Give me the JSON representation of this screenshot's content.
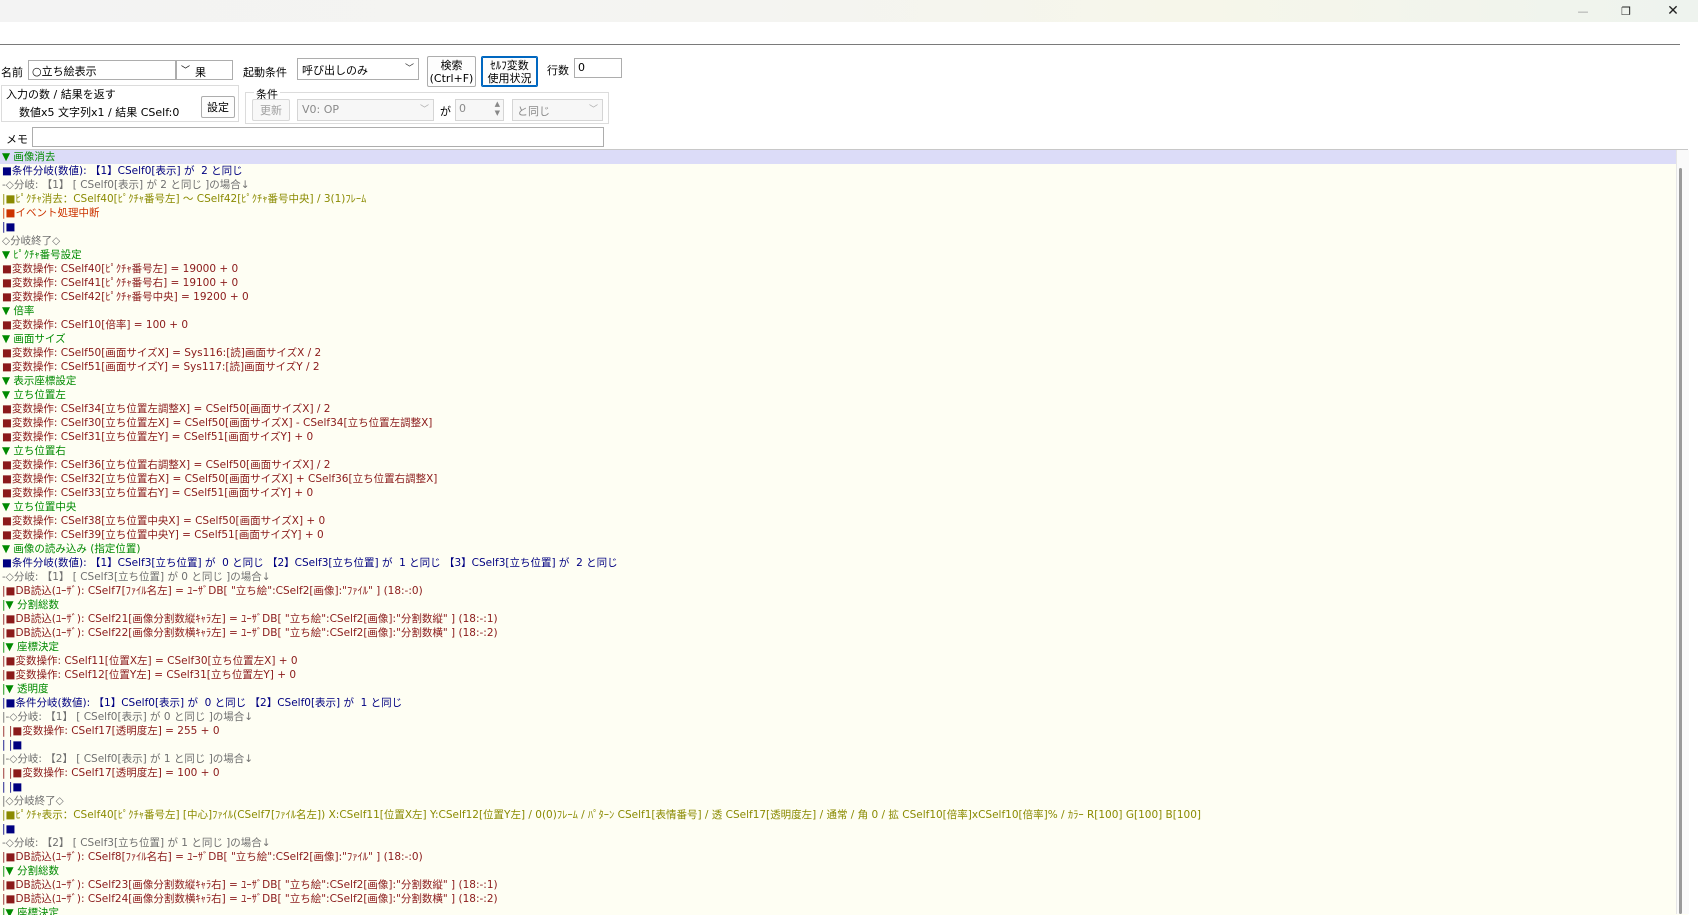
{
  "window": {
    "minimize_glyph": "—",
    "maximize_glyph": "❐",
    "close_glyph": "✕"
  },
  "toolbar": {
    "name_label": "名前",
    "name_value": "○立ち絵表示",
    "view_value": "果",
    "trigger_label": "起動条件",
    "trigger_value": "呼び出しのみ",
    "search_button": [
      "検索",
      "(Ctrl+F)"
    ],
    "self_var_button": [
      "ｾﾙﾌ変数",
      "使用状況"
    ],
    "row_count_label": "行数",
    "row_count_value": "0",
    "io_label": "入力の数 / 結果を返す",
    "io_value": "数値x5 文字列x1 / 結果 CSelf:0",
    "settings_button": "設定",
    "condition_label": "条件",
    "update_button": "更新",
    "cond_var_value": "V0: OP",
    "ga_label": "が",
    "cond_num_value": "0",
    "cond_op_value": "と同じ",
    "memo_label": "メモ",
    "memo_value": ""
  },
  "colors": {
    "comment": "#008a00",
    "command": "#8b1a1a",
    "branch": "#000080",
    "grey": "#707070",
    "picture": "#8a8a00",
    "event": "#cc3300"
  },
  "editor_lines": [
    {
      "t": "▼ 画像消去",
      "c": "comment"
    },
    {
      "t": "■条件分岐(数値): 【1】CSelf0[表示] が  2 と同じ",
      "c": "branch"
    },
    {
      "t": "-◇分岐: 【1】 [ CSelf0[表示] が 2 と同じ ]の場合↓",
      "c": "grey"
    },
    {
      "t": "|■ﾋﾟｸﾁｬ消去：CSelf40[ﾋﾟｸﾁｬ番号左] ～ CSelf42[ﾋﾟｸﾁｬ番号中央] / 3(1)ﾌﾚｰﾑ",
      "c": "picture"
    },
    {
      "t": "|■イベント処理中断",
      "c": "event"
    },
    {
      "t": "|■",
      "c": "branch"
    },
    {
      "t": "◇分岐終了◇",
      "c": "grey"
    },
    {
      "t": "▼ ﾋﾟｸﾁｬ番号設定",
      "c": "comment"
    },
    {
      "t": "■変数操作: CSelf40[ﾋﾟｸﾁｬ番号左] = 19000 + 0",
      "c": "command"
    },
    {
      "t": "■変数操作: CSelf41[ﾋﾟｸﾁｬ番号右] = 19100 + 0",
      "c": "command"
    },
    {
      "t": "■変数操作: CSelf42[ﾋﾟｸﾁｬ番号中央] = 19200 + 0",
      "c": "command"
    },
    {
      "t": "▼ 倍率",
      "c": "comment"
    },
    {
      "t": "■変数操作: CSelf10[倍率] = 100 + 0",
      "c": "command"
    },
    {
      "t": "▼ 画面サイズ",
      "c": "comment"
    },
    {
      "t": "■変数操作: CSelf50[画面サイズX] = Sys116:[読]画面サイズX / 2",
      "c": "command"
    },
    {
      "t": "■変数操作: CSelf51[画面サイズY] = Sys117:[読]画面サイズY / 2",
      "c": "command"
    },
    {
      "t": "▼ 表示座標設定",
      "c": "comment"
    },
    {
      "t": "▼ 立ち位置左",
      "c": "comment"
    },
    {
      "t": "■変数操作: CSelf34[立ち位置左調整X] = CSelf50[画面サイズX] / 2",
      "c": "command"
    },
    {
      "t": "■変数操作: CSelf30[立ち位置左X] = CSelf50[画面サイズX] - CSelf34[立ち位置左調整X]",
      "c": "command"
    },
    {
      "t": "■変数操作: CSelf31[立ち位置左Y] = CSelf51[画面サイズY] + 0",
      "c": "command"
    },
    {
      "t": "▼ 立ち位置右",
      "c": "comment"
    },
    {
      "t": "■変数操作: CSelf36[立ち位置右調整X] = CSelf50[画面サイズX] / 2",
      "c": "command"
    },
    {
      "t": "■変数操作: CSelf32[立ち位置右X] = CSelf50[画面サイズX] + CSelf36[立ち位置右調整X]",
      "c": "command"
    },
    {
      "t": "■変数操作: CSelf33[立ち位置右Y] = CSelf51[画面サイズY] + 0",
      "c": "command"
    },
    {
      "t": "▼ 立ち位置中央",
      "c": "comment"
    },
    {
      "t": "■変数操作: CSelf38[立ち位置中央X] = CSelf50[画面サイズX] + 0",
      "c": "command"
    },
    {
      "t": "■変数操作: CSelf39[立ち位置中央Y] = CSelf51[画面サイズY] + 0",
      "c": "command"
    },
    {
      "t": "▼ 画像の読み込み (指定位置)",
      "c": "comment"
    },
    {
      "t": "■条件分岐(数値): 【1】CSelf3[立ち位置] が  0 と同じ 【2】CSelf3[立ち位置] が  1 と同じ 【3】CSelf3[立ち位置] が  2 と同じ",
      "c": "branch"
    },
    {
      "t": "-◇分岐: 【1】 [ CSelf3[立ち位置] が 0 と同じ ]の場合↓",
      "c": "grey"
    },
    {
      "t": "|■DB読込(ﾕｰｻﾞ): CSelf7[ﾌｧｲﾙ名左] = ﾕｰｻﾞDB[ \"立ち絵\":CSelf2[画像]:\"ﾌｧｲﾙ\" ] (18:-:0)",
      "c": "command"
    },
    {
      "t": "|▼ 分割総数",
      "c": "comment"
    },
    {
      "t": "|■DB読込(ﾕｰｻﾞ): CSelf21[画像分割数縦ｷｬﾗ左] = ﾕｰｻﾞDB[ \"立ち絵\":CSelf2[画像]:\"分割数縦\" ] (18:-:1)",
      "c": "command"
    },
    {
      "t": "|■DB読込(ﾕｰｻﾞ): CSelf22[画像分割数横ｷｬﾗ左] = ﾕｰｻﾞDB[ \"立ち絵\":CSelf2[画像]:\"分割数横\" ] (18:-:2)",
      "c": "command"
    },
    {
      "t": "|▼ 座標決定",
      "c": "comment"
    },
    {
      "t": "|■変数操作: CSelf11[位置X左] = CSelf30[立ち位置左X] + 0",
      "c": "command"
    },
    {
      "t": "|■変数操作: CSelf12[位置Y左] = CSelf31[立ち位置左Y] + 0",
      "c": "command"
    },
    {
      "t": "|▼ 透明度",
      "c": "comment"
    },
    {
      "t": "|■条件分岐(数値): 【1】CSelf0[表示] が  0 と同じ 【2】CSelf0[表示] が  1 と同じ",
      "c": "branch"
    },
    {
      "t": "|-◇分岐: 【1】 [ CSelf0[表示] が 0 と同じ ]の場合↓",
      "c": "grey"
    },
    {
      "t": "| |■変数操作: CSelf17[透明度左] = 255 + 0",
      "c": "command"
    },
    {
      "t": "| |■",
      "c": "branch"
    },
    {
      "t": "|-◇分岐: 【2】 [ CSelf0[表示] が 1 と同じ ]の場合↓",
      "c": "grey"
    },
    {
      "t": "| |■変数操作: CSelf17[透明度左] = 100 + 0",
      "c": "command"
    },
    {
      "t": "| |■",
      "c": "branch"
    },
    {
      "t": "|◇分岐終了◇",
      "c": "grey"
    },
    {
      "t": "|■ﾋﾟｸﾁｬ表示：CSelf40[ﾋﾟｸﾁｬ番号左] [中心]ﾌｧｲﾙ(CSelf7[ﾌｧｲﾙ名左]) X:CSelf11[位置X左] Y:CSelf12[位置Y左] / 0(0)ﾌﾚｰﾑ / ﾊﾟﾀｰﾝ CSelf1[表情番号] / 透 CSelf17[透明度左] / 通常 / 角 0 / 拡 CSelf10[倍率]xCSelf10[倍率]% / ｶﾗｰ R[100] G[100] B[100]",
      "c": "picture"
    },
    {
      "t": "|■",
      "c": "branch"
    },
    {
      "t": "-◇分岐: 【2】 [ CSelf3[立ち位置] が 1 と同じ ]の場合↓",
      "c": "grey"
    },
    {
      "t": "|■DB読込(ﾕｰｻﾞ): CSelf8[ﾌｧｲﾙ名右] = ﾕｰｻﾞDB[ \"立ち絵\":CSelf2[画像]:\"ﾌｧｲﾙ\" ] (18:-:0)",
      "c": "command"
    },
    {
      "t": "|▼ 分割総数",
      "c": "comment"
    },
    {
      "t": "|■DB読込(ﾕｰｻﾞ): CSelf23[画像分割数縦ｷｬﾗ右] = ﾕｰｻﾞDB[ \"立ち絵\":CSelf2[画像]:\"分割数縦\" ] (18:-:1)",
      "c": "command"
    },
    {
      "t": "|■DB読込(ﾕｰｻﾞ): CSelf24[画像分割数横ｷｬﾗ右] = ﾕｰｻﾞDB[ \"立ち絵\":CSelf2[画像]:\"分割数横\" ] (18:-:2)",
      "c": "command"
    },
    {
      "t": "|▼ 座標決定",
      "c": "comment"
    }
  ]
}
